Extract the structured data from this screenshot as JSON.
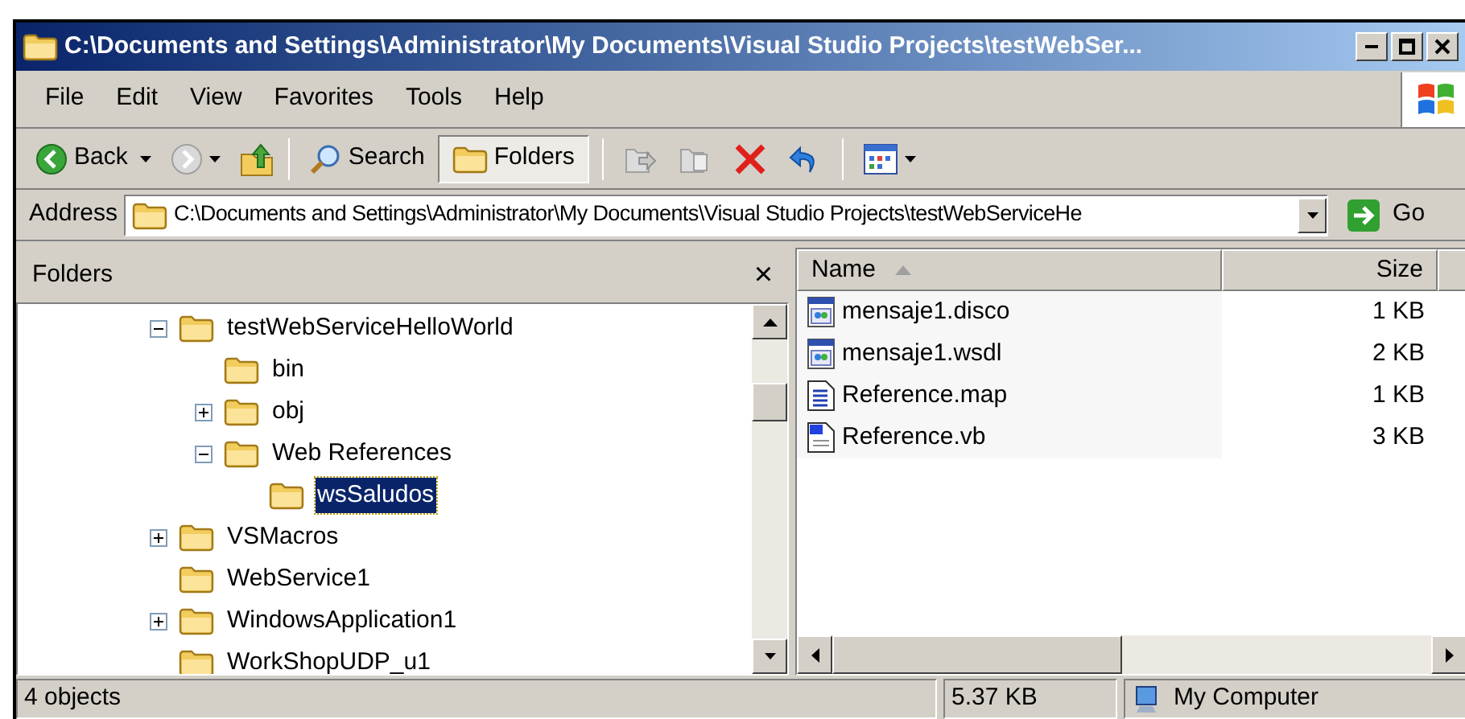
{
  "window": {
    "title": "C:\\Documents and Settings\\Administrator\\My Documents\\Visual Studio Projects\\testWebSer..."
  },
  "menu": [
    "File",
    "Edit",
    "View",
    "Favorites",
    "Tools",
    "Help"
  ],
  "toolbar": [
    {
      "kind": "back",
      "label": "Back"
    },
    {
      "kind": "forward"
    },
    {
      "kind": "up"
    },
    {
      "kind": "sep"
    },
    {
      "kind": "search",
      "label": "Search"
    },
    {
      "kind": "folders",
      "label": "Folders",
      "selected": true
    },
    {
      "kind": "sep"
    },
    {
      "kind": "moveto"
    },
    {
      "kind": "copyto"
    },
    {
      "kind": "delete"
    },
    {
      "kind": "undo"
    },
    {
      "kind": "sep"
    },
    {
      "kind": "views"
    }
  ],
  "address": {
    "label": "Address",
    "value": "C:\\Documents and Settings\\Administrator\\My Documents\\Visual Studio Projects\\testWebServiceHe",
    "go": "Go"
  },
  "folders": {
    "title": "Folders",
    "close": "×",
    "tree": [
      {
        "name": "testWebServiceHelloWorld",
        "expanded": true,
        "selected": false,
        "children": [
          {
            "name": "bin",
            "selected": false
          },
          {
            "name": "obj",
            "expanded": false,
            "selected": false
          },
          {
            "name": "Web References",
            "expanded": true,
            "selected": false,
            "children": [
              {
                "name": "wsSaludos",
                "selected": true
              }
            ]
          }
        ]
      },
      {
        "name": "VSMacros",
        "expanded": false,
        "selected": false
      },
      {
        "name": "WebService1",
        "selected": false
      },
      {
        "name": "WindowsApplication1",
        "expanded": false,
        "selected": false
      },
      {
        "name": "WorkShopUDP_u1",
        "selected": false
      }
    ]
  },
  "files": {
    "columns": [
      {
        "label": "Name",
        "sorted": true
      },
      {
        "label": "Size",
        "sorted": false
      },
      {
        "sorted": false
      }
    ],
    "rows": [
      {
        "name": "mensaje1.disco",
        "size": "1 KB",
        "kind": "web"
      },
      {
        "name": "mensaje1.wsdl",
        "size": "2 KB",
        "kind": "web"
      },
      {
        "name": "Reference.map",
        "size": "1 KB",
        "kind": "text"
      },
      {
        "name": "Reference.vb",
        "size": "3 KB",
        "kind": "vb"
      }
    ]
  },
  "status_bar": {
    "objects": "4 objects",
    "size": "5.37 KB",
    "zone": "My Computer"
  }
}
